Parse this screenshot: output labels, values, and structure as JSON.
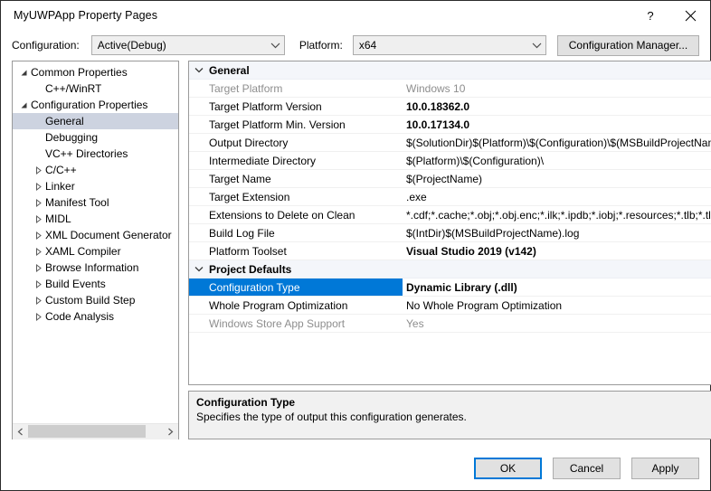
{
  "window": {
    "title": "MyUWPApp Property Pages",
    "help_icon": "help-icon",
    "close_icon": "close-icon",
    "help_glyph": "?",
    "close_glyph": "✕"
  },
  "configbar": {
    "configuration_label": "Configuration:",
    "configuration_value": "Active(Debug)",
    "platform_label": "Platform:",
    "platform_value": "x64",
    "configuration_manager_label": "Configuration Manager..."
  },
  "tree": {
    "items": [
      {
        "label": "Common Properties",
        "level": 0,
        "twisty": "expanded",
        "selected": false
      },
      {
        "label": "C++/WinRT",
        "level": 1,
        "twisty": "none",
        "selected": false
      },
      {
        "label": "Configuration Properties",
        "level": 0,
        "twisty": "expanded",
        "selected": false
      },
      {
        "label": "General",
        "level": 1,
        "twisty": "none",
        "selected": true
      },
      {
        "label": "Debugging",
        "level": 1,
        "twisty": "none",
        "selected": false
      },
      {
        "label": "VC++ Directories",
        "level": 1,
        "twisty": "none",
        "selected": false
      },
      {
        "label": "C/C++",
        "level": 1,
        "twisty": "collapsed",
        "selected": false
      },
      {
        "label": "Linker",
        "level": 1,
        "twisty": "collapsed",
        "selected": false
      },
      {
        "label": "Manifest Tool",
        "level": 1,
        "twisty": "collapsed",
        "selected": false
      },
      {
        "label": "MIDL",
        "level": 1,
        "twisty": "collapsed",
        "selected": false
      },
      {
        "label": "XML Document Generator",
        "level": 1,
        "twisty": "collapsed",
        "selected": false
      },
      {
        "label": "XAML Compiler",
        "level": 1,
        "twisty": "collapsed",
        "selected": false
      },
      {
        "label": "Browse Information",
        "level": 1,
        "twisty": "collapsed",
        "selected": false
      },
      {
        "label": "Build Events",
        "level": 1,
        "twisty": "collapsed",
        "selected": false
      },
      {
        "label": "Custom Build Step",
        "level": 1,
        "twisty": "collapsed",
        "selected": false
      },
      {
        "label": "Code Analysis",
        "level": 1,
        "twisty": "collapsed",
        "selected": false
      }
    ],
    "scrollbar": {
      "left_arrow": "❮",
      "right_arrow": "❯"
    }
  },
  "grid": {
    "sections": [
      {
        "title": "General",
        "rows": [
          {
            "name": "Target Platform",
            "value": "Windows 10",
            "style": "disabled"
          },
          {
            "name": "Target Platform Version",
            "value": "10.0.18362.0",
            "style": "bold"
          },
          {
            "name": "Target Platform Min. Version",
            "value": "10.0.17134.0",
            "style": "bold"
          },
          {
            "name": "Output Directory",
            "value": "$(SolutionDir)$(Platform)\\$(Configuration)\\$(MSBuildProjectName)\\",
            "style": "normal"
          },
          {
            "name": "Intermediate Directory",
            "value": "$(Platform)\\$(Configuration)\\",
            "style": "normal"
          },
          {
            "name": "Target Name",
            "value": "$(ProjectName)",
            "style": "normal"
          },
          {
            "name": "Target Extension",
            "value": ".exe",
            "style": "normal"
          },
          {
            "name": "Extensions to Delete on Clean",
            "value": "*.cdf;*.cache;*.obj;*.obj.enc;*.ilk;*.ipdb;*.iobj;*.resources;*.tlb;*.tli;*.tlh;*.tmp",
            "style": "normal"
          },
          {
            "name": "Build Log File",
            "value": "$(IntDir)$(MSBuildProjectName).log",
            "style": "normal"
          },
          {
            "name": "Platform Toolset",
            "value": "Visual Studio 2019 (v142)",
            "style": "bold"
          }
        ]
      },
      {
        "title": "Project Defaults",
        "rows": [
          {
            "name": "Configuration Type",
            "value": "Dynamic Library (.dll)",
            "style": "selected"
          },
          {
            "name": "Whole Program Optimization",
            "value": "No Whole Program Optimization",
            "style": "normal"
          },
          {
            "name": "Windows Store App Support",
            "value": "Yes",
            "style": "disabled"
          }
        ]
      }
    ]
  },
  "description": {
    "title": "Configuration Type",
    "text": "Specifies the type of output this configuration generates."
  },
  "footer": {
    "ok_label": "OK",
    "cancel_label": "Cancel",
    "apply_label": "Apply"
  },
  "colors": {
    "selection_blue": "#0078d7",
    "tree_selection": "#cdd3e0",
    "section_band": "#f4f6fa",
    "button_face": "#e1e1e1"
  }
}
